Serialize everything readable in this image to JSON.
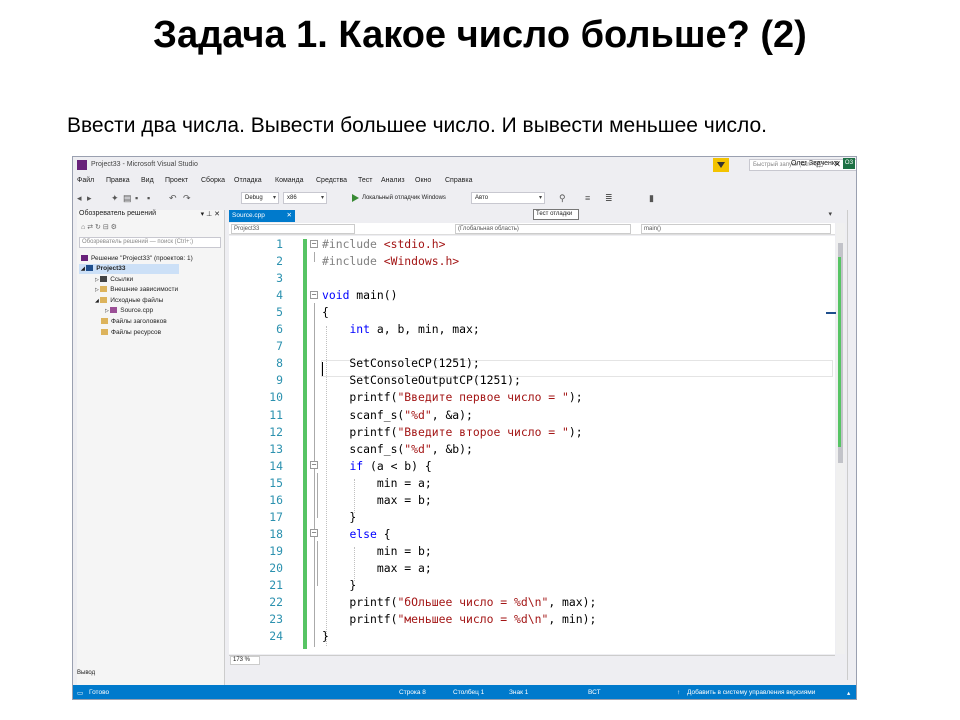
{
  "slide": {
    "title": "Задача 1. Какое число больше? (2)",
    "task": "Ввести два числа. Вывести большее число. И вывести меньшее число."
  },
  "window": {
    "title": "Project33 - Microsoft Visual Studio",
    "quick_launch_placeholder": "Быстрый запуск (Ctrl+Q)",
    "user_name": "Олег Зваченко",
    "user_initials": "ОЗ"
  },
  "menu": [
    "Файл",
    "Правка",
    "Вид",
    "Проект",
    "Сборка",
    "Отладка",
    "Команда",
    "Средства",
    "Тест",
    "Анализ",
    "Окно",
    "Справка"
  ],
  "toolbar": {
    "config": "Debug",
    "platform": "x86",
    "run_label": "Локальный отладчик Windows",
    "run_mode": "Авто"
  },
  "solution_explorer": {
    "title": "Обозреватель решений",
    "search_placeholder": "Обозреватель решений — поиск (Ctrl+;)",
    "items": [
      {
        "label": "Решение \"Project33\" (проектов: 1)",
        "icon": "solution-icon"
      },
      {
        "label": "Project33",
        "icon": "project-icon"
      },
      {
        "label": "Ссылки",
        "icon": "references-icon"
      },
      {
        "label": "Внешние зависимости",
        "icon": "folder-icon"
      },
      {
        "label": "Исходные файлы",
        "icon": "folder-icon"
      },
      {
        "label": "Source.cpp",
        "icon": "cpp-file-icon"
      },
      {
        "label": "Файлы заголовков",
        "icon": "folder-icon"
      },
      {
        "label": "Файлы ресурсов",
        "icon": "folder-icon"
      }
    ]
  },
  "editor": {
    "tab_label": "Source.cpp",
    "tooltip": "Тест отладки",
    "nav_project": "Project33",
    "nav_scope": "(Глобальная область)",
    "nav_member": "main()",
    "zoom": "173 %",
    "lines": [
      {
        "n": "1",
        "parts": [
          [
            "p",
            "#include "
          ],
          [
            "s",
            "<stdio.h>"
          ]
        ]
      },
      {
        "n": "2",
        "parts": [
          [
            "p",
            "#include "
          ],
          [
            "s",
            "<Windows.h>"
          ]
        ]
      },
      {
        "n": "3",
        "parts": []
      },
      {
        "n": "4",
        "parts": [
          [
            "k",
            "void"
          ],
          [
            "t",
            " main()"
          ]
        ]
      },
      {
        "n": "5",
        "parts": [
          [
            "t",
            "{"
          ]
        ]
      },
      {
        "n": "6",
        "parts": [
          [
            "t",
            "    "
          ],
          [
            "k",
            "int"
          ],
          [
            "t",
            " a, b, min, max;"
          ]
        ]
      },
      {
        "n": "7",
        "parts": []
      },
      {
        "n": "8",
        "parts": [
          [
            "t",
            "    SetConsoleCP(1251);"
          ]
        ]
      },
      {
        "n": "9",
        "parts": [
          [
            "t",
            "    SetConsoleOutputCP(1251);"
          ]
        ]
      },
      {
        "n": "10",
        "parts": [
          [
            "t",
            "    printf("
          ],
          [
            "s",
            "\"Введите первое число = \""
          ],
          [
            "t",
            ");"
          ]
        ]
      },
      {
        "n": "11",
        "parts": [
          [
            "t",
            "    scanf_s("
          ],
          [
            "s",
            "\"%d\""
          ],
          [
            "t",
            ", &a);"
          ]
        ]
      },
      {
        "n": "12",
        "parts": [
          [
            "t",
            "    printf("
          ],
          [
            "s",
            "\"Введите второе число = \""
          ],
          [
            "t",
            ");"
          ]
        ]
      },
      {
        "n": "13",
        "parts": [
          [
            "t",
            "    scanf_s("
          ],
          [
            "s",
            "\"%d\""
          ],
          [
            "t",
            ", &b);"
          ]
        ]
      },
      {
        "n": "14",
        "parts": [
          [
            "t",
            "    "
          ],
          [
            "k",
            "if"
          ],
          [
            "t",
            " (a < b) {"
          ]
        ]
      },
      {
        "n": "15",
        "parts": [
          [
            "t",
            "        min = a;"
          ]
        ]
      },
      {
        "n": "16",
        "parts": [
          [
            "t",
            "        max = b;"
          ]
        ]
      },
      {
        "n": "17",
        "parts": [
          [
            "t",
            "    }"
          ]
        ]
      },
      {
        "n": "18",
        "parts": [
          [
            "t",
            "    "
          ],
          [
            "k",
            "else"
          ],
          [
            "t",
            " {"
          ]
        ]
      },
      {
        "n": "19",
        "parts": [
          [
            "t",
            "        min = b;"
          ]
        ]
      },
      {
        "n": "20",
        "parts": [
          [
            "t",
            "        max = a;"
          ]
        ]
      },
      {
        "n": "21",
        "parts": [
          [
            "t",
            "    }"
          ]
        ]
      },
      {
        "n": "22",
        "parts": [
          [
            "t",
            "    printf("
          ],
          [
            "s",
            "\"бОльшее число = %d\\n\""
          ],
          [
            "t",
            ", max);"
          ]
        ]
      },
      {
        "n": "23",
        "parts": [
          [
            "t",
            "    printf("
          ],
          [
            "s",
            "\"меньшее число = %d\\n\""
          ],
          [
            "t",
            ", min);"
          ]
        ]
      },
      {
        "n": "24",
        "parts": [
          [
            "t",
            "}"
          ]
        ]
      }
    ]
  },
  "output_title": "Вывод",
  "status": {
    "ready": "Готово",
    "row": "Строка 8",
    "col": "Столбец 1",
    "char": "Знак 1",
    "mode": "ВСТ",
    "scm": "Добавить в систему управления версиями"
  },
  "colors": {
    "accent": "#007acc",
    "keyword": "#0000ff",
    "string": "#a31515",
    "line_number": "#2b91af",
    "change_bar": "#57c464"
  }
}
